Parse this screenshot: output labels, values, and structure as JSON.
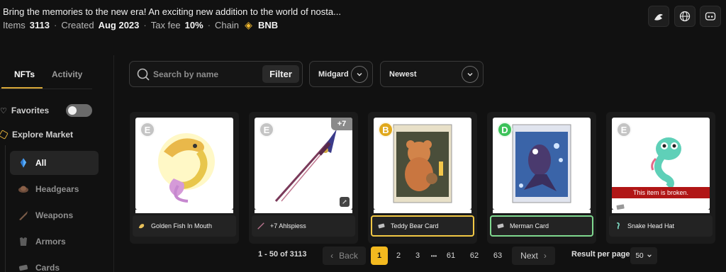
{
  "collection": {
    "description": "Bring the memories to the new era! An exciting new addition to the world of nosta...",
    "items_label": "Items",
    "items_value": "3113",
    "created_label": "Created",
    "created_value": "Aug 2023",
    "taxfee_label": "Tax fee",
    "taxfee_value": "10%",
    "chain_label": "Chain",
    "chain_value": "BNB"
  },
  "header_actions": [
    {
      "name": "marketplace-icon"
    },
    {
      "name": "globe-icon"
    },
    {
      "name": "discord-icon"
    }
  ],
  "sidebar": {
    "tabs": [
      "NFTs",
      "Activity"
    ],
    "favorites_label": "Favorites",
    "explore_label": "Explore Market",
    "categories": [
      {
        "label": "All",
        "icon": "crystal-icon",
        "active": true
      },
      {
        "label": "Headgears",
        "icon": "headgear-icon",
        "active": false
      },
      {
        "label": "Weapons",
        "icon": "weapon-icon",
        "active": false
      },
      {
        "label": "Armors",
        "icon": "armor-icon",
        "active": false
      },
      {
        "label": "Cards",
        "icon": "card-icon",
        "active": false
      }
    ]
  },
  "toolbar": {
    "search_placeholder": "Search by name",
    "filter_label": "Filter",
    "server_value": "Midgard",
    "sort_value": "Newest"
  },
  "cards": [
    {
      "name": "Golden Fish In Mouth",
      "grade": "E",
      "grade_color": "#c4c4c4",
      "border_color": "#ffffff"
    },
    {
      "name": "+7 Ahlspiess",
      "grade": "E",
      "grade_color": "#c4c4c4",
      "badge": "+7",
      "border_color": "#ffffff"
    },
    {
      "name": "Teddy Bear Card",
      "grade": "B",
      "grade_color": "#e0a81c",
      "border_color": "#f2c845"
    },
    {
      "name": "Merman Card",
      "grade": "D",
      "grade_color": "#3cc25a",
      "border_color": "#7fd88f"
    },
    {
      "name": "Snake Head Hat",
      "grade": "E",
      "grade_color": "#c4c4c4",
      "broken_text": "This item is broken.",
      "border_color": "#ffffff"
    }
  ],
  "pagination": {
    "range": "1 - 50 of 3113",
    "back_label": "Back",
    "next_label": "Next",
    "pages": [
      "1",
      "2",
      "3",
      "•••",
      "61",
      "62",
      "63"
    ],
    "current": "1",
    "rpp_label": "Result per page",
    "rpp_value": "50"
  }
}
